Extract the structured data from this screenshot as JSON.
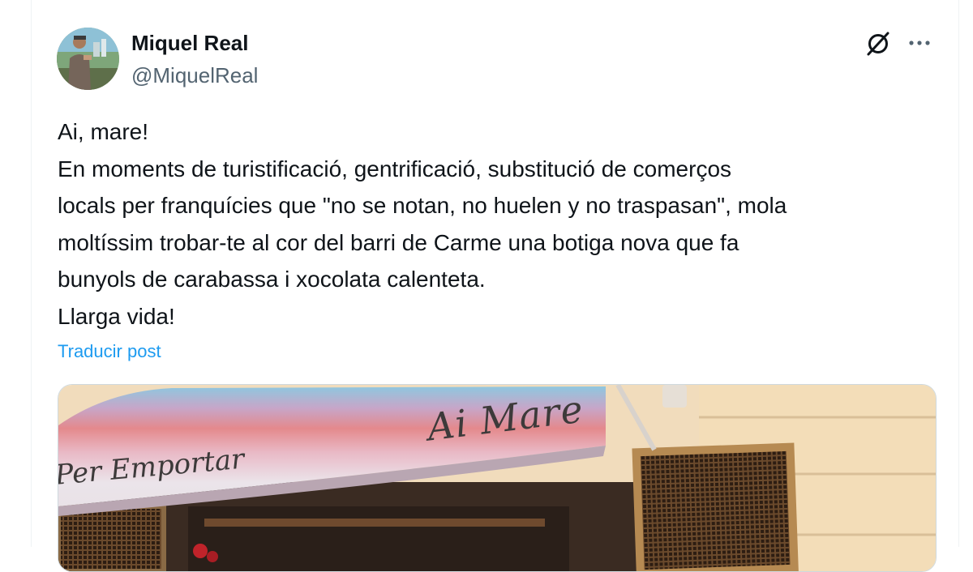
{
  "post": {
    "author": {
      "name": "Miquel Real",
      "handle": "@MiquelReal",
      "avatar_icon": "user-avatar"
    },
    "header_icons": [
      "grok-icon",
      "more-icon"
    ],
    "text_lines": [
      "Ai, mare!",
      "En moments de turistificació, gentrificació, substitució de comerços",
      "locals per franquícies que \"no se notan, no huelen y no traspasan\", mola",
      "moltíssim trobar-te al cor del barri de Carme una botiga nova que fa",
      "bunyols de carabassa i xocolata calenteta.",
      "Llarga vida!"
    ],
    "translate_label": "Traducir post",
    "media": {
      "awning_text_main": "Ai Mare",
      "awning_text_secondary": "Per Emportar"
    }
  },
  "colors": {
    "text_primary": "#0f1419",
    "text_secondary": "#536471",
    "link": "#1d9bf0",
    "border": "#cfd9de"
  }
}
